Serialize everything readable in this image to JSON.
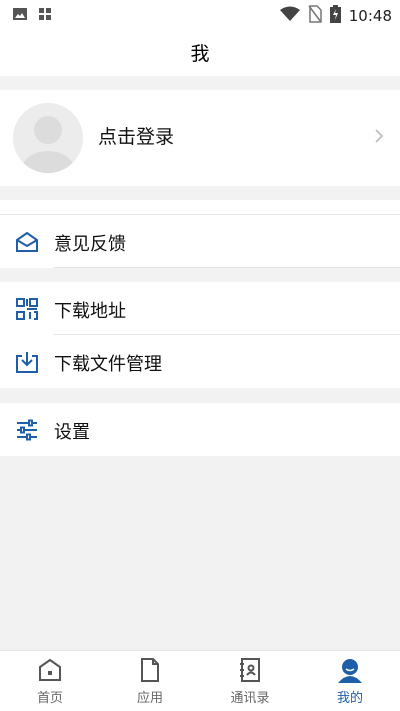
{
  "status_bar": {
    "time": "10:48",
    "icons": [
      "image-icon",
      "apps-icon",
      "wifi-icon",
      "no-sim-icon",
      "battery-charging-icon"
    ]
  },
  "header": {
    "title": "我"
  },
  "profile": {
    "login_label": "点击登录"
  },
  "menu": {
    "feedback": {
      "label": "意见反馈",
      "icon": "envelope-icon"
    },
    "download_address": {
      "label": "下载地址",
      "icon": "qr-code-icon"
    },
    "download_manager": {
      "label": "下载文件管理",
      "icon": "download-icon"
    },
    "settings": {
      "label": "设置",
      "icon": "sliders-icon"
    }
  },
  "tabbar": {
    "tabs": [
      {
        "label": "首页",
        "icon": "home-icon",
        "active": false
      },
      {
        "label": "应用",
        "icon": "document-icon",
        "active": false
      },
      {
        "label": "通讯录",
        "icon": "contacts-icon",
        "active": false
      },
      {
        "label": "我的",
        "icon": "user-icon",
        "active": true
      }
    ]
  },
  "colors": {
    "accent": "#1f5fa8",
    "inactive": "#666666",
    "background": "#f2f2f2",
    "card": "#ffffff"
  }
}
